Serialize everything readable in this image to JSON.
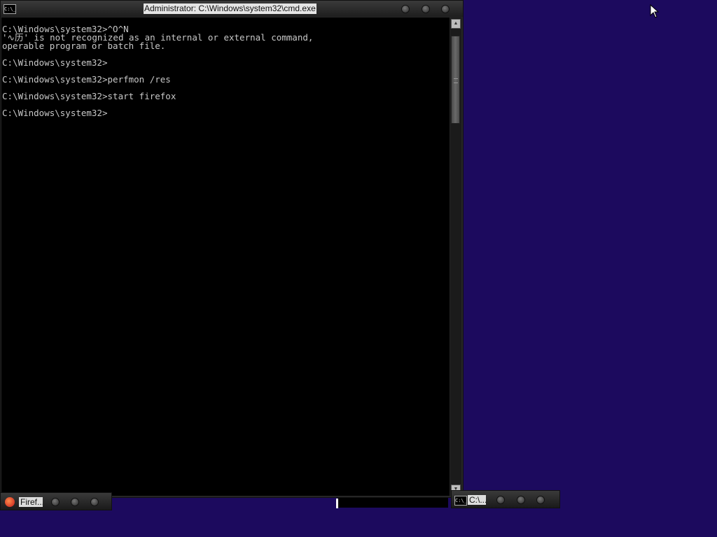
{
  "window": {
    "title": "Administrator: C:\\Windows\\system32\\cmd.exe",
    "icon": "cmd-icon",
    "icon_text": "C:\\_"
  },
  "console": {
    "lines": [
      "C:\\Windows\\system32>^O^N",
      "'∿历' is not recognized as an internal or external command,",
      "operable program or batch file.",
      "",
      "C:\\Windows\\system32>",
      "",
      "C:\\Windows\\system32>perfmon /res",
      "",
      "C:\\Windows\\system32>start firefox",
      "",
      "C:\\Windows\\system32>"
    ]
  },
  "taskbar": {
    "firefox_label": "Firef...",
    "cmd_label": "C:\\..."
  },
  "colors": {
    "desktop": "#1c0a5e",
    "console_bg": "#000000",
    "console_fg": "#c8c8c8"
  }
}
